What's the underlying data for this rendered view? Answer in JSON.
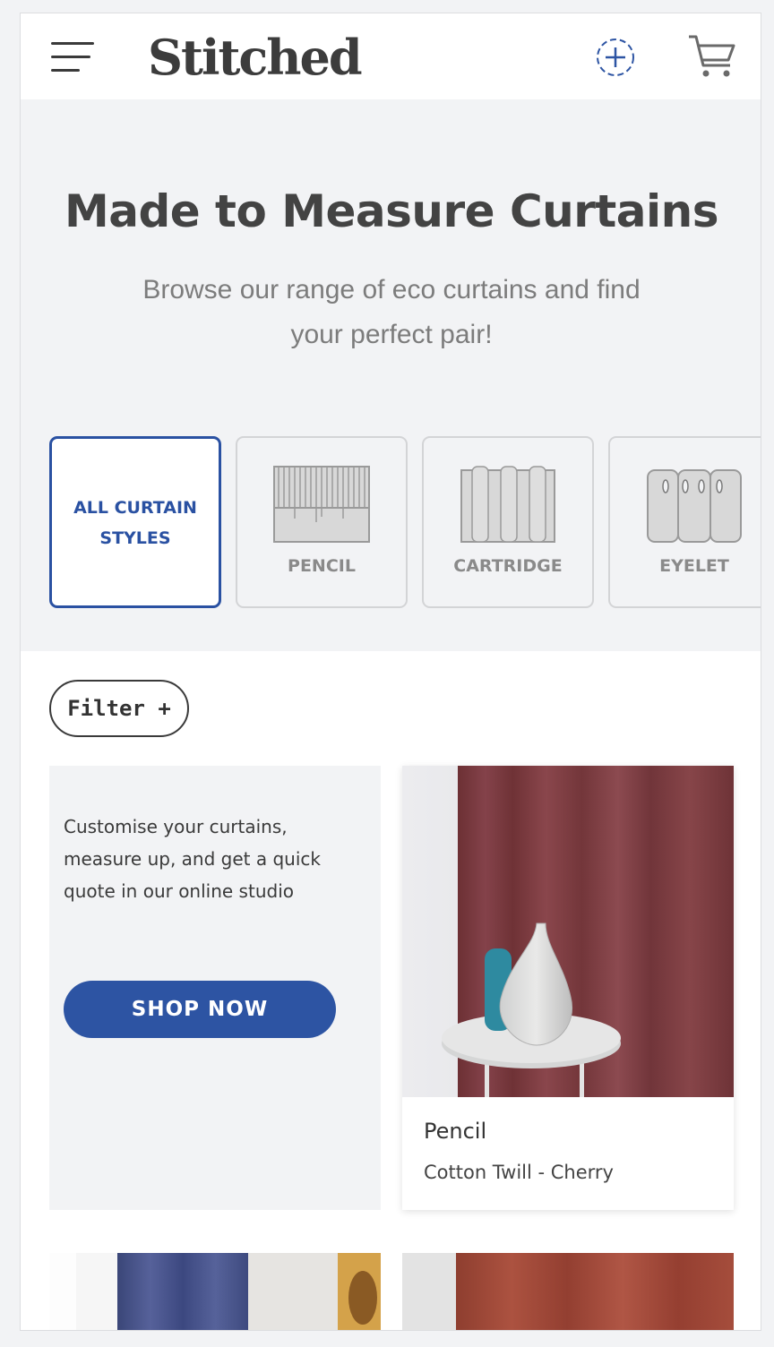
{
  "header": {
    "logo": "Stitched",
    "menu_icon": "hamburger-menu-icon",
    "add_icon": "add-circle-icon",
    "cart_icon": "cart-icon"
  },
  "hero": {
    "title": "Made to Measure Curtains",
    "subtitle": "Browse our range of eco curtains and find your perfect pair!"
  },
  "styles": {
    "items": [
      {
        "label": "ALL CURTAIN STYLES",
        "selected": true
      },
      {
        "label": "PENCIL",
        "icon": "pencil-pleat-icon"
      },
      {
        "label": "CARTRIDGE",
        "icon": "cartridge-pleat-icon"
      },
      {
        "label": "EYELET",
        "icon": "eyelet-curtain-icon"
      }
    ]
  },
  "filter": {
    "label": "Filter +"
  },
  "promo": {
    "text": "Customise your curtains, measure up, and get a quick quote in our online studio",
    "button": "SHOP NOW"
  },
  "products": [
    {
      "name": "Pencil",
      "description": "Cotton Twill - Cherry",
      "color": "#7e3c3f"
    }
  ],
  "colors": {
    "accent": "#2d54a3",
    "hero_bg": "#f2f3f5",
    "cherry": "#7e3c3f",
    "navy": "#3d4a80",
    "rust": "#a04a38"
  }
}
